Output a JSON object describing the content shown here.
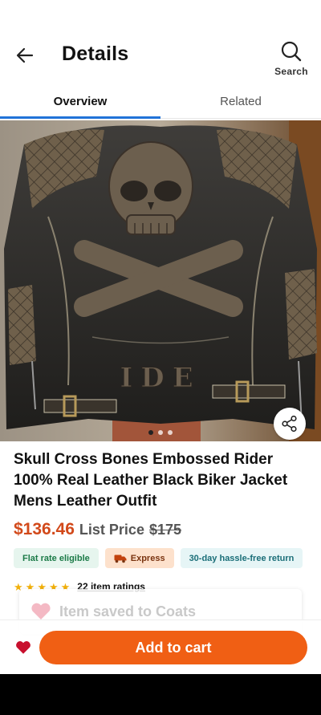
{
  "header": {
    "title": "Details",
    "search_label": "Search"
  },
  "tabs": [
    {
      "label": "Overview",
      "active": true
    },
    {
      "label": "Related",
      "active": false
    }
  ],
  "gallery": {
    "image_count": 3,
    "active_index": 0,
    "embossed_text": "IDE"
  },
  "product": {
    "title": "Skull Cross Bones Embossed Rider 100% Real Leather Black Biker Jacket Mens Leather Outfit",
    "price": "$136.46",
    "list_price_label": "List Price",
    "list_price": "$175"
  },
  "badges": {
    "flat_rate": "Flat rate eligible",
    "express": "Express",
    "returns": "30-day hassle-free return"
  },
  "rating": {
    "stars": 5,
    "count_text": "22 item ratings"
  },
  "toast": {
    "text": "Item saved to Coats"
  },
  "cart": {
    "label": "Add to cart"
  },
  "colors": {
    "accent": "#f05f14",
    "price": "#d2491a",
    "tab_indicator": "#2173d8",
    "favorite": "#c8102e"
  },
  "icons": [
    "back-arrow-icon",
    "search-icon",
    "share-icon",
    "heart-icon",
    "truck-icon",
    "star-icon"
  ]
}
